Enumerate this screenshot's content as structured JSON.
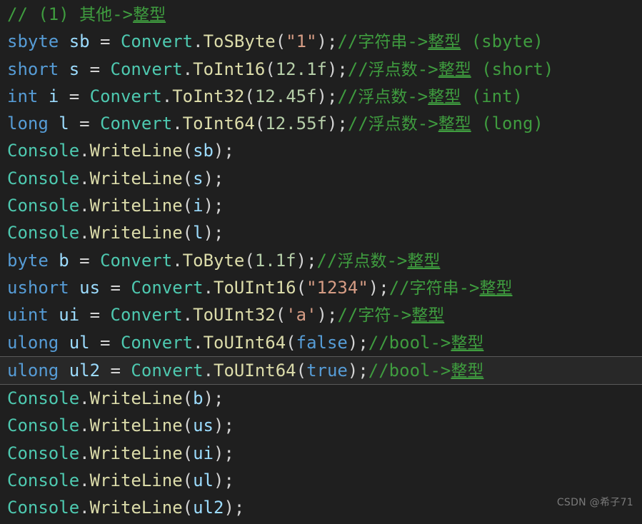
{
  "editor": {
    "language": "csharp",
    "background_color": "#1f1f1f",
    "current_line_background": "#282828",
    "current_line_border_color": "#5a5a5a",
    "current_line_index": 13,
    "total_lines": 19,
    "theme_colors": {
      "keyword": "#569cd6",
      "variable": "#9cdcfe",
      "class": "#4ec9b0",
      "method": "#dcdcaa",
      "number": "#b5cea8",
      "string": "#d69d85",
      "punctuation": "#d4d4d4",
      "comment": "#3f9c3f"
    }
  },
  "lines": [
    {
      "index": 0,
      "text": "// (1) 其他->整型",
      "tokens": [
        {
          "t": "// (1) 其他->",
          "c": "cmt"
        },
        {
          "t": "整型",
          "c": "cmt-sp"
        }
      ]
    },
    {
      "index": 1,
      "text": "sbyte sb = Convert.ToSByte(\"1\");//字符串->整型 (sbyte)",
      "tokens": [
        {
          "t": "sbyte",
          "c": "kw"
        },
        {
          "t": " ",
          "c": "pun"
        },
        {
          "t": "sb",
          "c": "var"
        },
        {
          "t": " = ",
          "c": "op"
        },
        {
          "t": "Convert",
          "c": "cls"
        },
        {
          "t": ".",
          "c": "pun"
        },
        {
          "t": "ToSByte",
          "c": "mth"
        },
        {
          "t": "(",
          "c": "pun"
        },
        {
          "t": "\"1\"",
          "c": "str"
        },
        {
          "t": ");",
          "c": "pun"
        },
        {
          "t": "//字符串->",
          "c": "cmt"
        },
        {
          "t": "整型",
          "c": "cmt-sp"
        },
        {
          "t": " (sbyte)",
          "c": "cmt"
        }
      ]
    },
    {
      "index": 2,
      "text": "short s = Convert.ToInt16(12.1f);//浮点数->整型 (short)",
      "tokens": [
        {
          "t": "short",
          "c": "kw"
        },
        {
          "t": " ",
          "c": "pun"
        },
        {
          "t": "s",
          "c": "var"
        },
        {
          "t": " = ",
          "c": "op"
        },
        {
          "t": "Convert",
          "c": "cls"
        },
        {
          "t": ".",
          "c": "pun"
        },
        {
          "t": "ToInt16",
          "c": "mth"
        },
        {
          "t": "(",
          "c": "pun"
        },
        {
          "t": "12.1f",
          "c": "num"
        },
        {
          "t": ");",
          "c": "pun"
        },
        {
          "t": "//浮点数->",
          "c": "cmt"
        },
        {
          "t": "整型",
          "c": "cmt-sp"
        },
        {
          "t": " (short)",
          "c": "cmt"
        }
      ]
    },
    {
      "index": 3,
      "text": "int i = Convert.ToInt32(12.45f);//浮点数->整型 (int)",
      "tokens": [
        {
          "t": "int",
          "c": "kw"
        },
        {
          "t": " ",
          "c": "pun"
        },
        {
          "t": "i",
          "c": "var"
        },
        {
          "t": " = ",
          "c": "op"
        },
        {
          "t": "Convert",
          "c": "cls"
        },
        {
          "t": ".",
          "c": "pun"
        },
        {
          "t": "ToInt32",
          "c": "mth"
        },
        {
          "t": "(",
          "c": "pun"
        },
        {
          "t": "12.45f",
          "c": "num"
        },
        {
          "t": ");",
          "c": "pun"
        },
        {
          "t": "//浮点数->",
          "c": "cmt"
        },
        {
          "t": "整型",
          "c": "cmt-sp"
        },
        {
          "t": " (int)",
          "c": "cmt"
        }
      ]
    },
    {
      "index": 4,
      "text": "long l = Convert.ToInt64(12.55f);//浮点数->整型 (long)",
      "tokens": [
        {
          "t": "long",
          "c": "kw"
        },
        {
          "t": " ",
          "c": "pun"
        },
        {
          "t": "l",
          "c": "var"
        },
        {
          "t": " = ",
          "c": "op"
        },
        {
          "t": "Convert",
          "c": "cls"
        },
        {
          "t": ".",
          "c": "pun"
        },
        {
          "t": "ToInt64",
          "c": "mth"
        },
        {
          "t": "(",
          "c": "pun"
        },
        {
          "t": "12.55f",
          "c": "num"
        },
        {
          "t": ");",
          "c": "pun"
        },
        {
          "t": "//浮点数->",
          "c": "cmt"
        },
        {
          "t": "整型",
          "c": "cmt-sp"
        },
        {
          "t": " (long)",
          "c": "cmt"
        }
      ]
    },
    {
      "index": 5,
      "text": "Console.WriteLine(sb);",
      "tokens": [
        {
          "t": "Console",
          "c": "cls"
        },
        {
          "t": ".",
          "c": "pun"
        },
        {
          "t": "WriteLine",
          "c": "mth"
        },
        {
          "t": "(",
          "c": "pun"
        },
        {
          "t": "sb",
          "c": "var"
        },
        {
          "t": ");",
          "c": "pun"
        }
      ]
    },
    {
      "index": 6,
      "text": "Console.WriteLine(s);",
      "tokens": [
        {
          "t": "Console",
          "c": "cls"
        },
        {
          "t": ".",
          "c": "pun"
        },
        {
          "t": "WriteLine",
          "c": "mth"
        },
        {
          "t": "(",
          "c": "pun"
        },
        {
          "t": "s",
          "c": "var"
        },
        {
          "t": ");",
          "c": "pun"
        }
      ]
    },
    {
      "index": 7,
      "text": "Console.WriteLine(i);",
      "tokens": [
        {
          "t": "Console",
          "c": "cls"
        },
        {
          "t": ".",
          "c": "pun"
        },
        {
          "t": "WriteLine",
          "c": "mth"
        },
        {
          "t": "(",
          "c": "pun"
        },
        {
          "t": "i",
          "c": "var"
        },
        {
          "t": ");",
          "c": "pun"
        }
      ]
    },
    {
      "index": 8,
      "text": "Console.WriteLine(l);",
      "tokens": [
        {
          "t": "Console",
          "c": "cls"
        },
        {
          "t": ".",
          "c": "pun"
        },
        {
          "t": "WriteLine",
          "c": "mth"
        },
        {
          "t": "(",
          "c": "pun"
        },
        {
          "t": "l",
          "c": "var"
        },
        {
          "t": ");",
          "c": "pun"
        }
      ]
    },
    {
      "index": 9,
      "text": "byte b = Convert.ToByte(1.1f);//浮点数->整型",
      "tokens": [
        {
          "t": "byte",
          "c": "kw"
        },
        {
          "t": " ",
          "c": "pun"
        },
        {
          "t": "b",
          "c": "var"
        },
        {
          "t": " = ",
          "c": "op"
        },
        {
          "t": "Convert",
          "c": "cls"
        },
        {
          "t": ".",
          "c": "pun"
        },
        {
          "t": "ToByte",
          "c": "mth"
        },
        {
          "t": "(",
          "c": "pun"
        },
        {
          "t": "1.1f",
          "c": "num"
        },
        {
          "t": ");",
          "c": "pun"
        },
        {
          "t": "//浮点数->",
          "c": "cmt"
        },
        {
          "t": "整型",
          "c": "cmt-sp"
        }
      ]
    },
    {
      "index": 10,
      "text": "ushort us = Convert.ToUInt16(\"1234\");//字符串->整型",
      "tokens": [
        {
          "t": "ushort",
          "c": "kw"
        },
        {
          "t": " ",
          "c": "pun"
        },
        {
          "t": "us",
          "c": "var"
        },
        {
          "t": " = ",
          "c": "op"
        },
        {
          "t": "Convert",
          "c": "cls"
        },
        {
          "t": ".",
          "c": "pun"
        },
        {
          "t": "ToUInt16",
          "c": "mth"
        },
        {
          "t": "(",
          "c": "pun"
        },
        {
          "t": "\"1234\"",
          "c": "str"
        },
        {
          "t": ");",
          "c": "pun"
        },
        {
          "t": "//字符串->",
          "c": "cmt"
        },
        {
          "t": "整型",
          "c": "cmt-sp"
        }
      ]
    },
    {
      "index": 11,
      "text": "uint ui = Convert.ToUInt32('a');//字符->整型",
      "tokens": [
        {
          "t": "uint",
          "c": "kw"
        },
        {
          "t": " ",
          "c": "pun"
        },
        {
          "t": "ui",
          "c": "var"
        },
        {
          "t": " = ",
          "c": "op"
        },
        {
          "t": "Convert",
          "c": "cls"
        },
        {
          "t": ".",
          "c": "pun"
        },
        {
          "t": "ToUInt32",
          "c": "mth"
        },
        {
          "t": "(",
          "c": "pun"
        },
        {
          "t": "'a'",
          "c": "str"
        },
        {
          "t": ");",
          "c": "pun"
        },
        {
          "t": "//字符->",
          "c": "cmt"
        },
        {
          "t": "整型",
          "c": "cmt-sp"
        }
      ]
    },
    {
      "index": 12,
      "text": "ulong ul = Convert.ToUInt64(false);//bool->整型",
      "tokens": [
        {
          "t": "ulong",
          "c": "kw"
        },
        {
          "t": " ",
          "c": "pun"
        },
        {
          "t": "ul",
          "c": "var"
        },
        {
          "t": " = ",
          "c": "op"
        },
        {
          "t": "Convert",
          "c": "cls"
        },
        {
          "t": ".",
          "c": "pun"
        },
        {
          "t": "ToUInt64",
          "c": "mth"
        },
        {
          "t": "(",
          "c": "pun"
        },
        {
          "t": "false",
          "c": "kw"
        },
        {
          "t": ");",
          "c": "pun"
        },
        {
          "t": "//bool->",
          "c": "cmt"
        },
        {
          "t": "整型",
          "c": "cmt-sp"
        }
      ]
    },
    {
      "index": 13,
      "current": true,
      "text": "ulong ul2 = Convert.ToUInt64(true);//bool->整型",
      "tokens": [
        {
          "t": "ulong",
          "c": "kw"
        },
        {
          "t": " ",
          "c": "pun"
        },
        {
          "t": "ul2",
          "c": "var"
        },
        {
          "t": " = ",
          "c": "op"
        },
        {
          "t": "Convert",
          "c": "cls"
        },
        {
          "t": ".",
          "c": "pun"
        },
        {
          "t": "ToUInt64",
          "c": "mth"
        },
        {
          "t": "(",
          "c": "pun"
        },
        {
          "t": "true",
          "c": "kw"
        },
        {
          "t": ");",
          "c": "pun"
        },
        {
          "t": "//bool->",
          "c": "cmt"
        },
        {
          "t": "整型",
          "c": "cmt-sp"
        }
      ]
    },
    {
      "index": 14,
      "text": "Console.WriteLine(b);",
      "tokens": [
        {
          "t": "Console",
          "c": "cls"
        },
        {
          "t": ".",
          "c": "pun"
        },
        {
          "t": "WriteLine",
          "c": "mth"
        },
        {
          "t": "(",
          "c": "pun"
        },
        {
          "t": "b",
          "c": "var"
        },
        {
          "t": ");",
          "c": "pun"
        }
      ]
    },
    {
      "index": 15,
      "text": "Console.WriteLine(us);",
      "tokens": [
        {
          "t": "Console",
          "c": "cls"
        },
        {
          "t": ".",
          "c": "pun"
        },
        {
          "t": "WriteLine",
          "c": "mth"
        },
        {
          "t": "(",
          "c": "pun"
        },
        {
          "t": "us",
          "c": "var"
        },
        {
          "t": ");",
          "c": "pun"
        }
      ]
    },
    {
      "index": 16,
      "text": "Console.WriteLine(ui);",
      "tokens": [
        {
          "t": "Console",
          "c": "cls"
        },
        {
          "t": ".",
          "c": "pun"
        },
        {
          "t": "WriteLine",
          "c": "mth"
        },
        {
          "t": "(",
          "c": "pun"
        },
        {
          "t": "ui",
          "c": "var"
        },
        {
          "t": ");",
          "c": "pun"
        }
      ]
    },
    {
      "index": 17,
      "text": "Console.WriteLine(ul);",
      "tokens": [
        {
          "t": "Console",
          "c": "cls"
        },
        {
          "t": ".",
          "c": "pun"
        },
        {
          "t": "WriteLine",
          "c": "mth"
        },
        {
          "t": "(",
          "c": "pun"
        },
        {
          "t": "ul",
          "c": "var"
        },
        {
          "t": ");",
          "c": "pun"
        }
      ]
    },
    {
      "index": 18,
      "text": "Console.WriteLine(ul2);",
      "tokens": [
        {
          "t": "Console",
          "c": "cls"
        },
        {
          "t": ".",
          "c": "pun"
        },
        {
          "t": "WriteLine",
          "c": "mth"
        },
        {
          "t": "(",
          "c": "pun"
        },
        {
          "t": "ul2",
          "c": "var"
        },
        {
          "t": ");",
          "c": "pun"
        }
      ]
    }
  ],
  "watermark": {
    "text": "CSDN @希子71"
  }
}
